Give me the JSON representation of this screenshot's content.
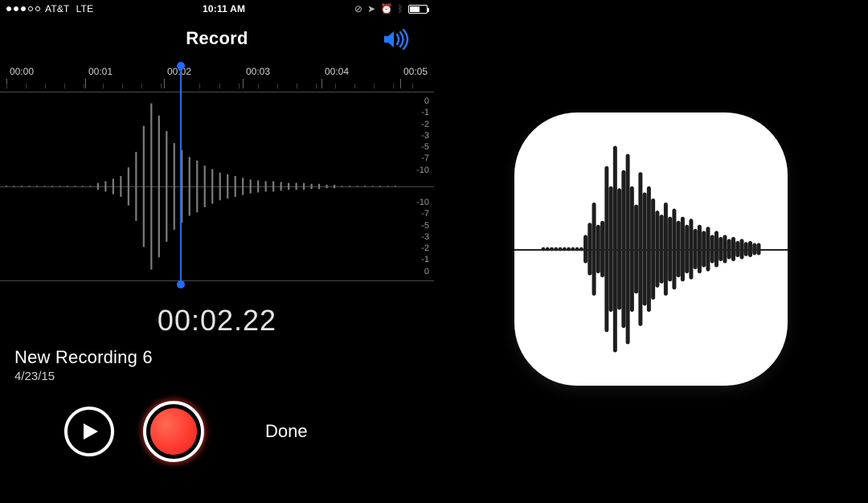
{
  "status": {
    "carrier": "AT&T",
    "net": "LTE",
    "time": "10:11 AM"
  },
  "header": {
    "title": "Record"
  },
  "ruler": {
    "labels": [
      "00:00",
      "00:01",
      "00:02",
      "00:03",
      "00:04",
      "00:05"
    ]
  },
  "db": {
    "top": [
      "0",
      "-1",
      "-2",
      "-3",
      "-5",
      "-7",
      "-10"
    ],
    "bottom": [
      "0",
      "-1",
      "-2",
      "-3",
      "-5",
      "-7",
      "-10"
    ]
  },
  "playhead": {
    "position_fraction": 0.415
  },
  "readout": {
    "elapsed": "00:02.22"
  },
  "recording": {
    "name": "New Recording 6",
    "date": "4/23/15"
  },
  "controls": {
    "done_label": "Done"
  },
  "phone_waveform": {
    "bars": [
      0,
      0,
      0,
      0,
      0,
      0,
      0,
      0,
      0,
      0,
      0,
      0,
      4,
      6,
      9,
      12,
      22,
      40,
      70,
      96,
      82,
      64,
      50,
      42,
      34,
      30,
      24,
      20,
      16,
      14,
      12,
      10,
      8,
      7,
      6,
      6,
      5,
      4,
      4,
      4,
      3,
      3,
      2,
      2,
      0,
      0,
      0,
      0,
      0,
      0,
      0,
      0
    ]
  },
  "icon_waveform": {
    "bars": [
      0,
      0,
      0,
      0,
      0,
      0,
      0,
      0,
      0,
      0,
      12,
      24,
      44,
      22,
      26,
      80,
      60,
      100,
      58,
      76,
      92,
      60,
      42,
      74,
      54,
      60,
      48,
      36,
      32,
      44,
      30,
      38,
      26,
      30,
      22,
      28,
      18,
      22,
      16,
      20,
      12,
      16,
      10,
      12,
      8,
      10,
      6,
      8,
      5,
      6,
      4,
      4
    ]
  }
}
